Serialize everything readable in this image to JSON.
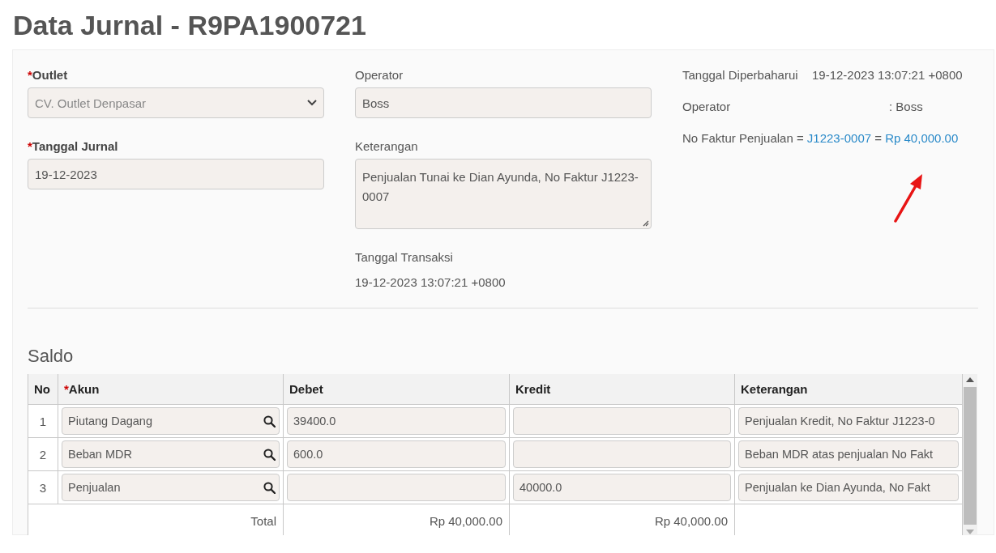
{
  "page_title": "Data Jurnal - R9PA1900721",
  "left": [
    {
      "kind": "select",
      "required_mark": "*",
      "label": "Outlet",
      "value": "CV. Outlet Denpasar",
      "disabled": true
    },
    {
      "kind": "input",
      "required_mark": "*",
      "label": "Tanggal Jurnal",
      "value": "19-12-2023",
      "disabled": false
    }
  ],
  "middle": [
    {
      "kind": "input",
      "label": "Operator",
      "value": "Boss"
    },
    {
      "kind": "textarea",
      "label": "Keterangan",
      "value": "Penjualan Tunai ke Dian Ayunda, No Faktur J1223-0007"
    },
    {
      "kind": "text",
      "label": "Tanggal Transaksi",
      "value": "19-12-2023 13:07:21 +0800"
    }
  ],
  "info": {
    "updated_label": "Tanggal Diperbaharui",
    "updated_value": "19-12-2023 13:07:21 +0800",
    "operator_label": "Operator",
    "operator_value": ": Boss",
    "invoice_text": "No Faktur Penjualan =",
    "invoice_link": "J1223-0007",
    "separator": "=",
    "amount_link": "Rp 40,000.00"
  },
  "saldo": {
    "title": "Saldo",
    "columns": [
      {
        "label": "No"
      },
      {
        "label": "Akun",
        "required_mark": "*"
      },
      {
        "label": "Debet"
      },
      {
        "label": "Kredit"
      },
      {
        "label": "Keterangan"
      }
    ],
    "rows": [
      {
        "no": "1",
        "akun": "Piutang Dagang",
        "debet": "39400.0",
        "kredit": "",
        "keterangan": "Penjualan Kredit, No Faktur J1223-0"
      },
      {
        "no": "2",
        "akun": "Beban MDR",
        "debet": "600.0",
        "kredit": "",
        "keterangan": "Beban MDR atas penjualan No Fakt"
      },
      {
        "no": "3",
        "akun": "Penjualan",
        "debet": "",
        "kredit": "40000.0",
        "keterangan": "Penjualan ke Dian Ayunda, No Fakt"
      }
    ],
    "total": {
      "label": "Total",
      "debet": "Rp 40,000.00",
      "kredit": "Rp 40,000.00"
    }
  }
}
